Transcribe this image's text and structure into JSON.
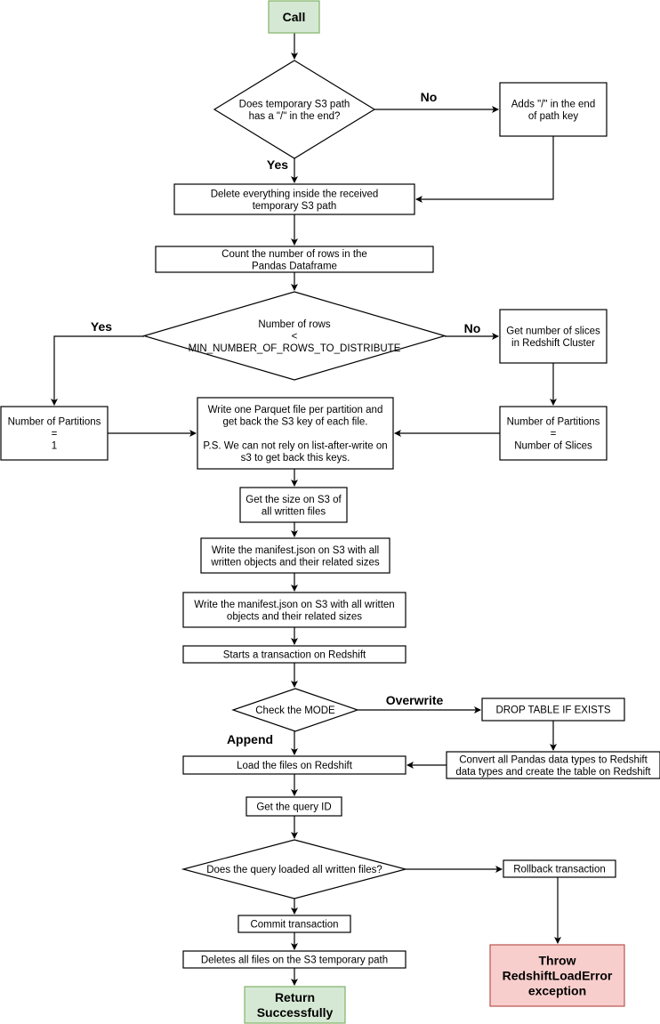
{
  "diagram": {
    "type": "flowchart",
    "colors": {
      "start_fill": "#d5e8d4",
      "start_stroke": "#82b366",
      "error_fill": "#f8cecc",
      "error_stroke": "#b85450",
      "default_fill": "#ffffff",
      "line": "#000000"
    },
    "nodes": {
      "call": {
        "shape": "rect",
        "style": "start",
        "lines": [
          "Call"
        ]
      },
      "check_slash": {
        "shape": "diamond",
        "lines": [
          "Does temporary S3 path",
          "has a \"/\" in the end?"
        ]
      },
      "add_slash": {
        "shape": "rect",
        "lines": [
          "Adds \"/\" in the end",
          "of path key"
        ]
      },
      "delete_path": {
        "shape": "rect",
        "lines": [
          "Delete everything inside the received",
          "temporary S3 path"
        ]
      },
      "count_rows": {
        "shape": "rect",
        "lines": [
          "Count the number of rows in the",
          "Pandas Dataframe"
        ]
      },
      "check_rows": {
        "shape": "diamond",
        "lines": [
          "Number of rows",
          "<",
          "MIN_NUMBER_OF_ROWS_TO_DISTRIBUTE"
        ]
      },
      "get_slices": {
        "shape": "rect",
        "lines": [
          "Get number of slices",
          "in Redshift Cluster"
        ]
      },
      "partitions_one": {
        "shape": "rect",
        "lines": [
          "Number of Partitions",
          "=",
          "1"
        ]
      },
      "write_parquet": {
        "shape": "rect",
        "lines": [
          "Write one Parquet file per partition and",
          "get back the S3 key of each file.",
          "",
          "P.S. We can not rely on list-after-write on",
          "s3 to get back this keys."
        ]
      },
      "partitions_slices": {
        "shape": "rect",
        "lines": [
          "Number of Partitions",
          "=",
          "Number of Slices"
        ]
      },
      "get_size": {
        "shape": "rect",
        "lines": [
          "Get the size on S3 of",
          "all written files"
        ]
      },
      "manifest_1": {
        "shape": "rect",
        "lines": [
          "Write the manifest.json on S3 with all",
          "written objects and their related sizes"
        ]
      },
      "manifest_2": {
        "shape": "rect",
        "lines": [
          "Write the manifest.json on S3 with all written",
          "objects and their related sizes"
        ]
      },
      "start_tx": {
        "shape": "rect",
        "lines": [
          "Starts a transaction on Redshift"
        ]
      },
      "check_mode": {
        "shape": "diamond",
        "lines": [
          "Check the MODE"
        ]
      },
      "drop_table": {
        "shape": "rect",
        "lines": [
          "DROP TABLE IF EXISTS"
        ]
      },
      "convert_types": {
        "shape": "rect",
        "lines": [
          "Convert all Pandas data types to Redshift",
          "data types and create the table on Redshift"
        ]
      },
      "load_files": {
        "shape": "rect",
        "lines": [
          "Load the files on Redshift"
        ]
      },
      "get_query_id": {
        "shape": "rect",
        "lines": [
          "Get the query ID"
        ]
      },
      "check_loaded": {
        "shape": "diamond",
        "lines": [
          "Does the query loaded all written files?"
        ]
      },
      "rollback": {
        "shape": "rect",
        "lines": [
          "Rollback transaction"
        ]
      },
      "commit": {
        "shape": "rect",
        "lines": [
          "Commit transaction"
        ]
      },
      "delete_files": {
        "shape": "rect",
        "lines": [
          "Deletes all files on the S3 temporary path"
        ]
      },
      "return_ok": {
        "shape": "rect",
        "style": "start",
        "lines": [
          "Return",
          "Successfully"
        ]
      },
      "throw_error": {
        "shape": "rect",
        "style": "error",
        "lines": [
          "Throw",
          "RedshiftLoadError",
          "exception"
        ]
      }
    },
    "edge_labels": {
      "slash_no": "No",
      "slash_yes": "Yes",
      "rows_yes": "Yes",
      "rows_no": "No",
      "mode_overwrite": "Overwrite",
      "mode_append": "Append"
    },
    "edges": [
      {
        "from": "call",
        "to": "check_slash"
      },
      {
        "from": "check_slash",
        "to": "add_slash",
        "label": "No"
      },
      {
        "from": "check_slash",
        "to": "delete_path",
        "label": "Yes"
      },
      {
        "from": "add_slash",
        "to": "delete_path"
      },
      {
        "from": "delete_path",
        "to": "count_rows"
      },
      {
        "from": "count_rows",
        "to": "check_rows"
      },
      {
        "from": "check_rows",
        "to": "partitions_one",
        "label": "Yes"
      },
      {
        "from": "check_rows",
        "to": "get_slices",
        "label": "No"
      },
      {
        "from": "get_slices",
        "to": "partitions_slices"
      },
      {
        "from": "partitions_one",
        "to": "write_parquet"
      },
      {
        "from": "partitions_slices",
        "to": "write_parquet"
      },
      {
        "from": "write_parquet",
        "to": "get_size"
      },
      {
        "from": "get_size",
        "to": "manifest_1"
      },
      {
        "from": "manifest_1",
        "to": "manifest_2"
      },
      {
        "from": "manifest_2",
        "to": "start_tx"
      },
      {
        "from": "start_tx",
        "to": "check_mode"
      },
      {
        "from": "check_mode",
        "to": "drop_table",
        "label": "Overwrite"
      },
      {
        "from": "check_mode",
        "to": "load_files",
        "label": "Append"
      },
      {
        "from": "drop_table",
        "to": "convert_types"
      },
      {
        "from": "convert_types",
        "to": "load_files"
      },
      {
        "from": "load_files",
        "to": "get_query_id"
      },
      {
        "from": "get_query_id",
        "to": "check_loaded"
      },
      {
        "from": "check_loaded",
        "to": "rollback"
      },
      {
        "from": "check_loaded",
        "to": "commit"
      },
      {
        "from": "rollback",
        "to": "throw_error"
      },
      {
        "from": "commit",
        "to": "delete_files"
      },
      {
        "from": "delete_files",
        "to": "return_ok"
      }
    ]
  }
}
